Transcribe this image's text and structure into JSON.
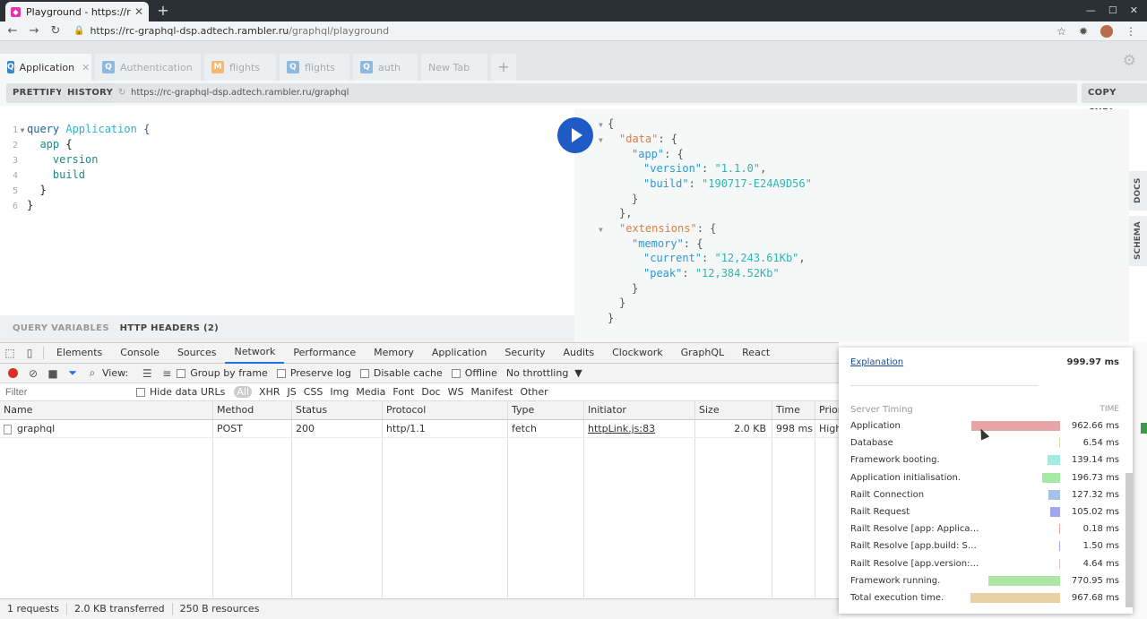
{
  "browser": {
    "tab_title": "Playground - https://rc-gr",
    "url_host": "https://rc-graphql-dsp.adtech.rambler.ru",
    "url_path": "/graphql/playground"
  },
  "playground": {
    "tabs": [
      {
        "badge": "Q",
        "label": "Application",
        "color": "#3a85c9",
        "active": true
      },
      {
        "badge": "Q",
        "label": "Authentication",
        "color": "#8fb8de"
      },
      {
        "badge": "M",
        "label": "flights",
        "color": "#f5b971"
      },
      {
        "badge": "Q",
        "label": "flights",
        "color": "#8fb8de"
      },
      {
        "badge": "Q",
        "label": "auth",
        "color": "#8fb8de"
      },
      {
        "label": "New Tab"
      }
    ],
    "prettify_label": "PRETTIFY",
    "history_label": "HISTORY",
    "endpoint": "https://rc-graphql-dsp.adtech.rambler.ru/graphql",
    "copy_curl_label": "COPY CURL",
    "query_lines": [
      "1",
      "2",
      "3",
      "4",
      "5",
      "6"
    ],
    "query_keyword": "query",
    "query_name": "Application",
    "query_field_app": "app",
    "query_field_version": "version",
    "query_field_build": "build",
    "query_variables_label": "QUERY VARIABLES",
    "http_headers_label": "HTTP HEADERS (2)",
    "docs_label": "DOCS",
    "schema_label": "SCHEMA",
    "result": {
      "data_key": "\"data\"",
      "app_key": "\"app\"",
      "version_key": "\"version\"",
      "version_val": "\"1.1.0\"",
      "build_key": "\"build\"",
      "build_val": "\"190717-E24A9D56\"",
      "extensions_key": "\"extensions\"",
      "memory_key": "\"memory\"",
      "current_key": "\"current\"",
      "current_val": "\"12,243.61Kb\"",
      "peak_key": "\"peak\"",
      "peak_val": "\"12,384.52Kb\""
    }
  },
  "devtools": {
    "tabs": [
      "Elements",
      "Console",
      "Sources",
      "Network",
      "Performance",
      "Memory",
      "Application",
      "Security",
      "Audits",
      "Clockwork",
      "GraphQL",
      "React"
    ],
    "active_tab": "Network",
    "view_label": "View:",
    "group_by_frame": "Group by frame",
    "preserve_log": "Preserve log",
    "disable_cache": "Disable cache",
    "offline": "Offline",
    "throttling": "No throttling",
    "filter_placeholder": "Filter",
    "hide_data_urls": "Hide data URLs",
    "filter_types": [
      "All",
      "XHR",
      "JS",
      "CSS",
      "Img",
      "Media",
      "Font",
      "Doc",
      "WS",
      "Manifest",
      "Other"
    ],
    "columns": [
      "Name",
      "Method",
      "Status",
      "Protocol",
      "Type",
      "Initiator",
      "Size",
      "Time",
      "Priori"
    ],
    "row": {
      "name": "graphql",
      "method": "POST",
      "status": "200",
      "protocol": "http/1.1",
      "type": "fetch",
      "initiator": "httpLink.js:83",
      "size": "2.0 KB",
      "time": "998 ms",
      "priority": "High"
    },
    "status_bar": [
      "1 requests",
      "2.0 KB transferred",
      "250 B resources"
    ]
  },
  "timing": {
    "explanation_label": "Explanation",
    "explanation_value": "999.97 ms",
    "server_timing_label": "Server Timing",
    "time_label": "TIME",
    "rows": [
      {
        "label": "Application",
        "value": "962.66 ms",
        "ms": 962.66,
        "color": "#e8a5a8"
      },
      {
        "label": "Database",
        "value": "6.54 ms",
        "ms": 6.54,
        "color": "#cde6a3"
      },
      {
        "label": "Framework booting.",
        "value": "139.14 ms",
        "ms": 139.14,
        "color": "#a1ede5"
      },
      {
        "label": "Application initialisation.",
        "value": "196.73 ms",
        "ms": 196.73,
        "color": "#a6eaa8"
      },
      {
        "label": "Railt Connection",
        "value": "127.32 ms",
        "ms": 127.32,
        "color": "#a7c2e8"
      },
      {
        "label": "Railt Request",
        "value": "105.02 ms",
        "ms": 105.02,
        "color": "#a2a6ec"
      },
      {
        "label": "Railt Resolve [app: Applica…",
        "value": "0.18 ms",
        "ms": 0.18,
        "color": "#e9a6a6"
      },
      {
        "label": "Railt Resolve [app.build: S…",
        "value": "1.50 ms",
        "ms": 1.5,
        "color": "#a2a4ea"
      },
      {
        "label": "Railt Resolve [app.version:…",
        "value": "4.64 ms",
        "ms": 4.64,
        "color": "#e8c3d6"
      },
      {
        "label": "Framework running.",
        "value": "770.95 ms",
        "ms": 770.95,
        "color": "#aee6a6"
      },
      {
        "label": "Total execution time.",
        "value": "967.68 ms",
        "ms": 967.68,
        "color": "#ebd0a6"
      }
    ]
  }
}
